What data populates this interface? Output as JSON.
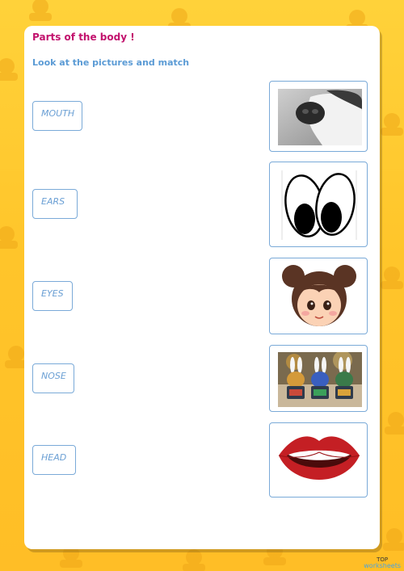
{
  "header": {
    "title": "Parts of the body !",
    "instruction": "Look at the pictures and match"
  },
  "words": [
    {
      "label": "MOUTH"
    },
    {
      "label": "EARS"
    },
    {
      "label": "EYES"
    },
    {
      "label": "NOSE"
    },
    {
      "label": "HEAD"
    }
  ],
  "pictures": [
    {
      "icon": "dog-nose-photo"
    },
    {
      "icon": "cartoon-eyes"
    },
    {
      "icon": "cartoon-girl-head"
    },
    {
      "icon": "bunny-ears-figures"
    },
    {
      "icon": "smiling-lips"
    }
  ],
  "footer": {
    "brand_top": "TOP",
    "brand_bottom": "worksheets"
  },
  "colors": {
    "background": "#ffc52a",
    "title": "#c2126d",
    "instruction": "#5b9bd5",
    "box_border": "#7aaad8"
  }
}
